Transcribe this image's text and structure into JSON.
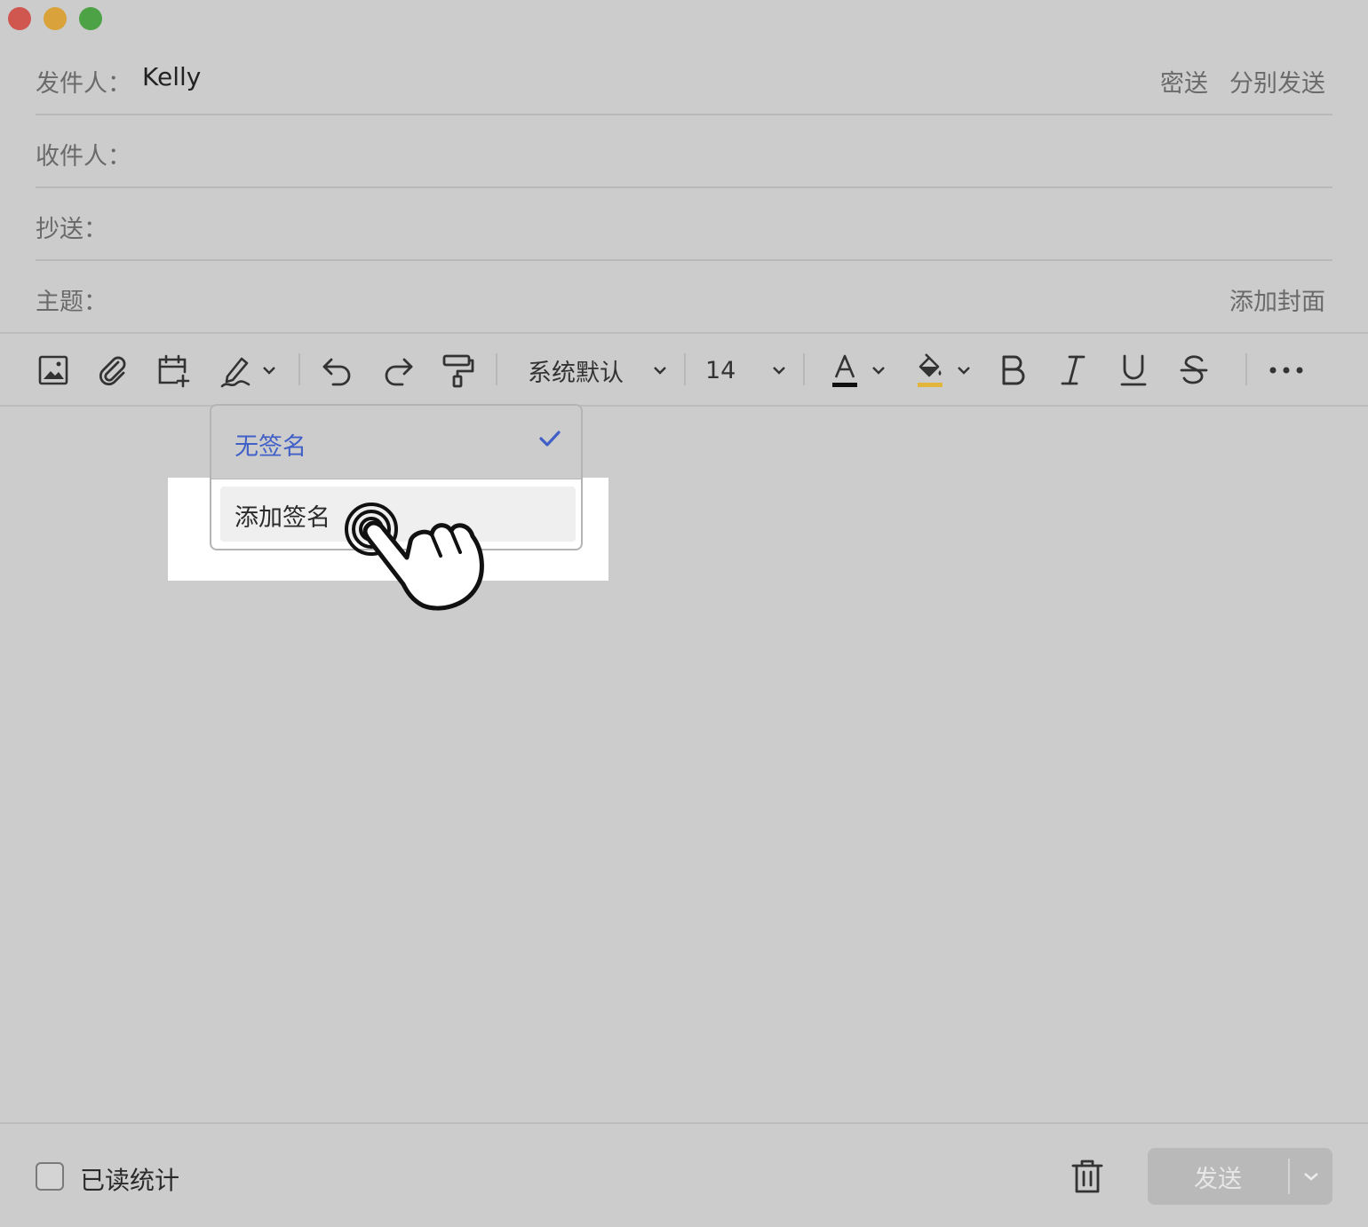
{
  "window": {
    "traffic_lights": [
      "close",
      "minimize",
      "maximize"
    ]
  },
  "compose": {
    "from": {
      "label": "发件人：",
      "value": "Kelly",
      "actions": [
        "密送",
        "分别发送"
      ]
    },
    "to": {
      "label": "收件人："
    },
    "cc": {
      "label": "抄送："
    },
    "subject": {
      "label": "主题：",
      "action": "添加封面"
    }
  },
  "toolbar": {
    "icons": [
      "image-icon",
      "attachment-icon",
      "calendar-add-icon",
      "signature-icon",
      "undo-icon",
      "redo-icon",
      "format-painter-icon",
      "font-color-icon",
      "highlight-color-icon",
      "bold-icon",
      "italic-icon",
      "underline-icon",
      "strikethrough-icon",
      "more-icon"
    ],
    "font_family": "系统默认",
    "font_size": "14",
    "font_color_bar": "#111111",
    "highlight_color_bar": "#e2b53c"
  },
  "signature_menu": {
    "items": [
      {
        "label": "无签名",
        "selected": true
      },
      {
        "label": "添加签名",
        "selected": false
      }
    ],
    "selected_color": "#4060c8"
  },
  "footer": {
    "read_receipt_label": "已读统计",
    "read_receipt_checked": false,
    "send_label": "发送"
  }
}
